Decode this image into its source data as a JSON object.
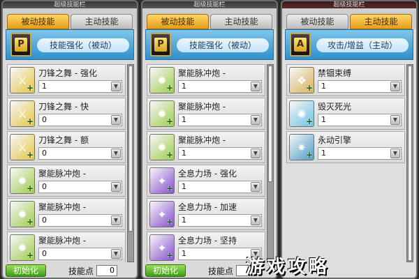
{
  "panels": [
    {
      "title": "超级技能栏",
      "tabs": [
        "被动技能",
        "主动技能"
      ],
      "active_tab": 0,
      "header": {
        "letter": "P",
        "title": "技能强化（被动）"
      },
      "skills": [
        {
          "name": "刀锋之舞 - 强化",
          "level": "1",
          "icon": "sword-buff-icon"
        },
        {
          "name": "刀锋之舞 - 快",
          "level": "0",
          "icon": "sword-buff-icon"
        },
        {
          "name": "刀锋之舞 - 额",
          "level": "0",
          "icon": "sword-buff-icon"
        },
        {
          "name": "聚能脉冲炮 -",
          "level": "0",
          "icon": "cannon-icon"
        },
        {
          "name": "聚能脉冲炮 -",
          "level": "0",
          "icon": "cannon-icon"
        },
        {
          "name": "聚能脉冲炮 -",
          "level": "0",
          "icon": "cannon-icon"
        }
      ],
      "footer": {
        "init_label": "初始化",
        "sp_label": "技能点",
        "sp_value": "0"
      },
      "scroll_ratio": 0.85
    },
    {
      "title": "超级技能栏",
      "tabs": [
        "被动技能",
        "主动技能"
      ],
      "active_tab": 0,
      "header": {
        "letter": "P",
        "title": "技能强化（被动）"
      },
      "skills": [
        {
          "name": "聚能脉冲炮 -",
          "level": "1",
          "icon": "cannon-icon"
        },
        {
          "name": "聚能脉冲炮 -",
          "level": "1",
          "icon": "cannon-icon"
        },
        {
          "name": "聚能脉冲炮 -",
          "level": "1",
          "icon": "cannon-icon"
        },
        {
          "name": "全息力场 - 强化",
          "level": "1",
          "icon": "hologram-icon"
        },
        {
          "name": "全息力场 - 加速",
          "level": "1",
          "icon": "hologram-icon"
        },
        {
          "name": "全息力场 - 坚持",
          "level": "1",
          "icon": "hologram-icon"
        }
      ],
      "footer": {
        "init_label": "初始化",
        "sp_label": "技能点",
        "sp_value": "0"
      },
      "scroll_ratio": 0.6
    },
    {
      "title": "超级技能栏",
      "tabs": [
        "被动技能",
        "主动技能"
      ],
      "active_tab": 1,
      "header": {
        "letter": "A",
        "title": "攻击/增益（主动）"
      },
      "skills": [
        {
          "name": "禁锢束缚",
          "level": "1",
          "icon": "scroll-bind-icon"
        },
        {
          "name": "毁灭死光",
          "level": "1",
          "icon": "ice-ray-icon"
        },
        {
          "name": "永动引擎",
          "level": "1",
          "icon": "engine-icon"
        }
      ],
      "footer": {
        "init_label": "",
        "sp_label": "",
        "sp_value": ""
      },
      "scroll_ratio": 1.0
    }
  ],
  "icon_colors": {
    "sword-buff-icon": "#e7c84a",
    "cannon-icon": "#9fcf4f",
    "hologram-icon": "#8a4fd1",
    "scroll-bind-icon": "#d9b45a",
    "ice-ray-icon": "#6fc3e6",
    "engine-icon": "#4e9ec9"
  },
  "icon_glyphs": {
    "sword-buff-icon": "⚔",
    "cannon-icon": "✹",
    "hologram-icon": "✦",
    "scroll-bind-icon": "❖",
    "ice-ray-icon": "✺",
    "engine-icon": "✷"
  },
  "watermark": "游戏攻略"
}
